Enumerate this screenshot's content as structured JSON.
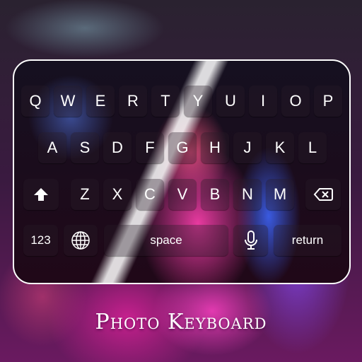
{
  "keyboard": {
    "row1": [
      "Q",
      "W",
      "E",
      "R",
      "T",
      "Y",
      "U",
      "I",
      "O",
      "P"
    ],
    "row2": [
      "A",
      "S",
      "D",
      "F",
      "G",
      "H",
      "J",
      "K",
      "L"
    ],
    "row3": [
      "Z",
      "X",
      "C",
      "V",
      "B",
      "N",
      "M"
    ],
    "num_label": "123",
    "space_label": "space",
    "return_label": "return",
    "icons": {
      "shift": "shift-arrow-icon",
      "backspace": "backspace-icon",
      "globe": "globe-icon",
      "mic": "microphone-icon"
    }
  },
  "title": "Photo Keyboard",
  "colors": {
    "accent": "#e23ab0",
    "text": "#ffffff"
  }
}
